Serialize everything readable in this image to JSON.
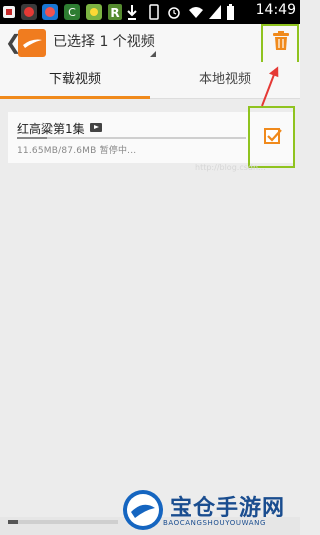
{
  "status_bar": {
    "time": "14:49",
    "icons": [
      "notification-icon",
      "app-icon",
      "app-icon",
      "app-icon",
      "r-app-icon",
      "download-icon",
      "vibrate-icon",
      "alarm-icon",
      "wifi-icon",
      "signal-icon",
      "battery-icon"
    ]
  },
  "action_bar": {
    "back_glyph": "❮",
    "title": "已选择 1 个视频"
  },
  "tabs": [
    {
      "label": "下载视频",
      "active": true
    },
    {
      "label": "本地视频",
      "active": false
    }
  ],
  "items": [
    {
      "title": "红高粱第1集",
      "status": "11.65MB/87.6MB   暂停中...",
      "progress": 0.133,
      "checked": true
    }
  ],
  "storage": {
    "used_fraction": 0.09
  },
  "watermark": {
    "title": "宝仓手游网",
    "subtitle": "BAOCANGSHOUYOUWANG",
    "faint": "http://blog.csdn..."
  },
  "colors": {
    "accent": "#f08a1c",
    "highlight": "#8fc31f",
    "arrow": "#e53935",
    "status_bar": "#000000"
  }
}
